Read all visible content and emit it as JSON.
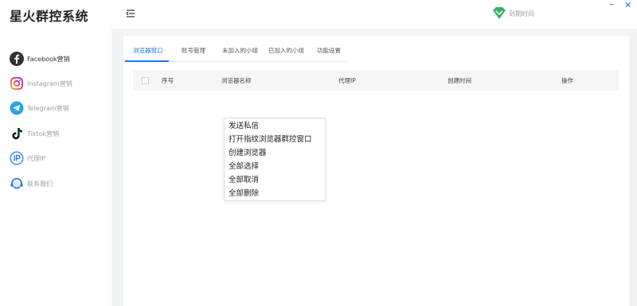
{
  "app": {
    "title": "星火群控系统"
  },
  "brand": {
    "text": "到期时间"
  },
  "window": {
    "minimize": "–",
    "close": "✕"
  },
  "colors": {
    "accent": "#1677ff",
    "brand_green": "#3bb36b",
    "facebook": "#333333",
    "telegram": "#2aa3df",
    "proxy": "#3d7de6"
  },
  "sidebar": {
    "items": [
      {
        "label": "Facebook营销",
        "icon": "facebook-icon",
        "active": true
      },
      {
        "label": "Instagram营销",
        "icon": "instagram-icon",
        "active": false
      },
      {
        "label": "Telegram营销",
        "icon": "telegram-icon",
        "active": false
      },
      {
        "label": "Tiktok营销",
        "icon": "tiktok-icon",
        "active": false
      },
      {
        "label": "代理IP",
        "icon": "proxy-ip-icon",
        "active": false
      },
      {
        "label": "联系我们",
        "icon": "support-icon",
        "active": false
      }
    ]
  },
  "tabs": [
    {
      "label": "浏览器窗口",
      "active": true
    },
    {
      "label": "账号管理",
      "active": false
    },
    {
      "label": "未加入的小组",
      "active": false
    },
    {
      "label": "已加入的小组",
      "active": false
    },
    {
      "label": "功能设置",
      "active": false
    }
  ],
  "table": {
    "columns": [
      "序号",
      "浏览器名称",
      "代理IP",
      "创建时间",
      "操作"
    ],
    "rows": []
  },
  "context_menu": {
    "items": [
      "发送私信",
      "打开指纹浏览器群控窗口",
      "创建浏览器",
      "全部选择",
      "全部取消",
      "全部删除"
    ]
  }
}
